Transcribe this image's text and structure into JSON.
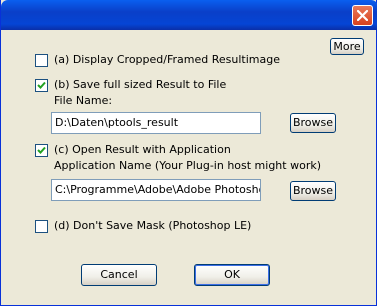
{
  "window": {
    "close_icon": "close-icon"
  },
  "buttons": {
    "more": "More",
    "browse_file": "Browse",
    "browse_app": "Browse",
    "cancel": "Cancel",
    "ok": "OK"
  },
  "options": {
    "a": {
      "label": "(a) Display Cropped/Framed Resultimage",
      "checked": false
    },
    "b": {
      "label": "(b) Save full sized Result to File",
      "checked": true
    },
    "c": {
      "label": "(c) Open Result with Application",
      "checked": true
    },
    "d": {
      "label": "(d) Don't Save Mask (Photoshop LE)",
      "checked": false
    }
  },
  "file": {
    "label": "File Name:",
    "value": "D:\\Daten\\ptools_result"
  },
  "application": {
    "label": "Application Name (Your Plug-in host might work)",
    "value": "C:\\Programme\\Adobe\\Adobe Photoshop"
  },
  "colors": {
    "title_bar": "#0a3fc8",
    "dialog_bg": "#ece9d8",
    "close_red": "#d9411e"
  }
}
